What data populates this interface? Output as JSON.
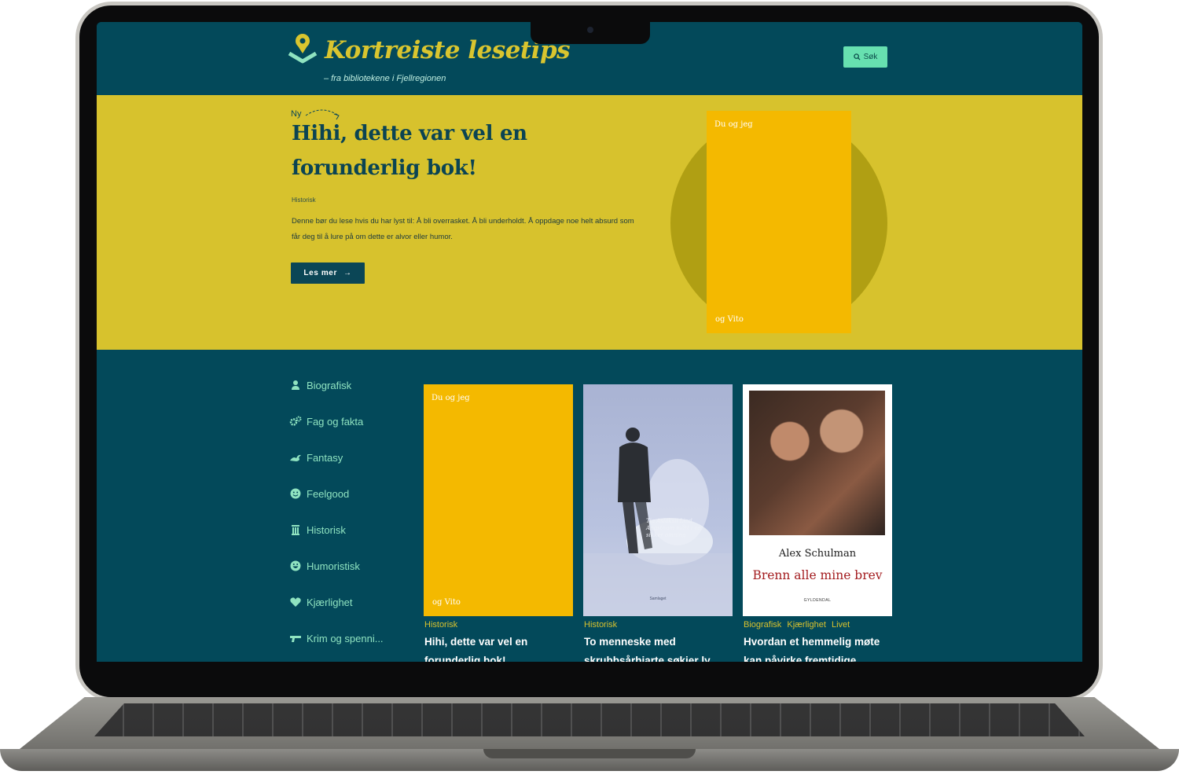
{
  "site": {
    "title": "Kortreiste lesetips",
    "subtitle": "– fra bibliotekene i Fjellregionen",
    "search_label": "Søk"
  },
  "hero": {
    "badge": "Ny",
    "title": "Hihi, dette var vel en forunderlig bok!",
    "genre": "Historisk",
    "description": "Denne bør du lese hvis du har lyst til: Å bli overrasket. Å bli underholdt. Å oppdage noe helt absurd som får deg til å lure på om dette er alvor eller humor.",
    "button_label": "Les mer",
    "button_arrow": "→",
    "cover": {
      "top_text": "Du og jeg",
      "bottom_text": "og Vito"
    }
  },
  "categories": [
    {
      "label": "Biografisk",
      "icon": "user-icon"
    },
    {
      "label": "Fag og fakta",
      "icon": "gears-icon"
    },
    {
      "label": "Fantasy",
      "icon": "dragon-icon"
    },
    {
      "label": "Feelgood",
      "icon": "smile-icon"
    },
    {
      "label": "Historisk",
      "icon": "column-icon"
    },
    {
      "label": "Humoristisk",
      "icon": "laugh-icon"
    },
    {
      "label": "Kjærlighet",
      "icon": "heart-icon"
    },
    {
      "label": "Krim og spenni...",
      "icon": "gun-icon"
    }
  ],
  "books": [
    {
      "genres": [
        "Historisk"
      ],
      "title": "Hihi, dette var vel en forunderlig bok!",
      "cover": {
        "top_text": "Du og jeg",
        "bottom_text": "og Vito"
      }
    },
    {
      "genres": [
        "Historisk"
      ],
      "title": "To menneske med skrubbsårhjarte søkjer ly",
      "cover": {
        "quote": "Tia Aslaksli Lind Angstnum mått i ca sikker omning",
        "publisher": "Samlaget"
      }
    },
    {
      "genres": [
        "Biografisk",
        "Kjærlighet",
        "Livet"
      ],
      "title": "Hvordan et hemmelig møte kan påvirke fremtidige",
      "cover": {
        "author": "Alex Schulman",
        "book_title": "Brenn alle mine brev",
        "publisher": "GYLDENDAL"
      }
    }
  ],
  "colors": {
    "primary_teal": "#03495a",
    "hero_yellow": "#d7c22d",
    "accent_mint": "#67e0b0",
    "cover_yellow": "#f4b900",
    "title_gold": "#d9c52f"
  }
}
